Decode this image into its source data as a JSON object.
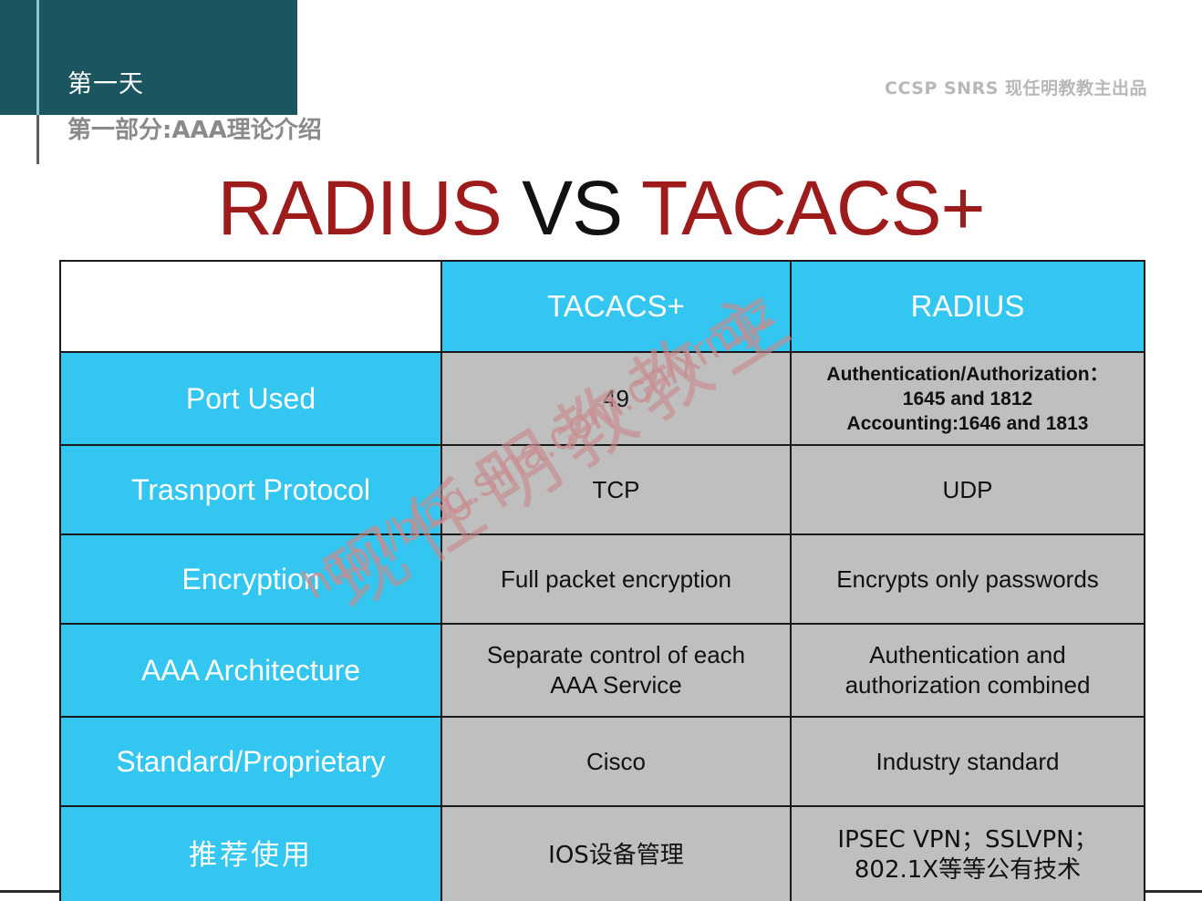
{
  "header": {
    "day_label": "第一天",
    "section_label": "第一部分:AAA理论介绍",
    "brand_label": "CCSP SNRS 现任明教教主出品",
    "block_color": "#1b5560",
    "rule_color": "#8fc6cf"
  },
  "title": {
    "left": "RADIUS",
    "middle": "VS",
    "right": "TACACS+",
    "accent_color": "#9e1b1b",
    "middle_color": "#111111"
  },
  "table": {
    "colors": {
      "header_bg": "#33c6f0",
      "label_bg": "#33c6f0",
      "value_bg": "#bfbfbf",
      "border": "#1a1a1a",
      "header_text": "#ffffff",
      "value_text": "#111111"
    },
    "columns": [
      "",
      "TACACS+",
      "RADIUS"
    ],
    "rows": [
      {
        "label": "Port Used",
        "label_cjk": false,
        "tacacs": [
          "49"
        ],
        "radius": [
          "Authentication/Authorization：",
          "1645 and 1812",
          "Accounting:1646 and 1813"
        ],
        "radius_style": "bold-small",
        "tacacs_style": ""
      },
      {
        "label": "Trasnport Protocol",
        "label_cjk": false,
        "tacacs": [
          "TCP"
        ],
        "radius": [
          "UDP"
        ],
        "radius_style": "",
        "tacacs_style": ""
      },
      {
        "label": "Encryption",
        "label_cjk": false,
        "tacacs": [
          "Full packet encryption"
        ],
        "radius": [
          "Encrypts only passwords"
        ],
        "radius_style": "",
        "tacacs_style": ""
      },
      {
        "label": "AAA Architecture",
        "label_cjk": false,
        "tacacs": [
          "Separate control of each",
          "AAA Service"
        ],
        "radius": [
          "Authentication and",
          "authorization combined"
        ],
        "radius_style": "",
        "tacacs_style": ""
      },
      {
        "label": "Standard/Proprietary",
        "label_cjk": false,
        "tacacs": [
          "Cisco"
        ],
        "radius": [
          "Industry standard"
        ],
        "radius_style": "",
        "tacacs_style": ""
      },
      {
        "label": "推荐使用",
        "label_cjk": true,
        "tacacs": [
          "IOS设备管理"
        ],
        "radius": [
          "IPSEC VPN；SSLVPN；",
          "802.1X等等公有技术"
        ],
        "radius_style": "cjk",
        "tacacs_style": "cjk"
      }
    ]
  },
  "watermark": {
    "url": "http://blog.sina.com.cn/xrmjjz",
    "cjk": "现任明教教主",
    "color": "#c98e90"
  }
}
